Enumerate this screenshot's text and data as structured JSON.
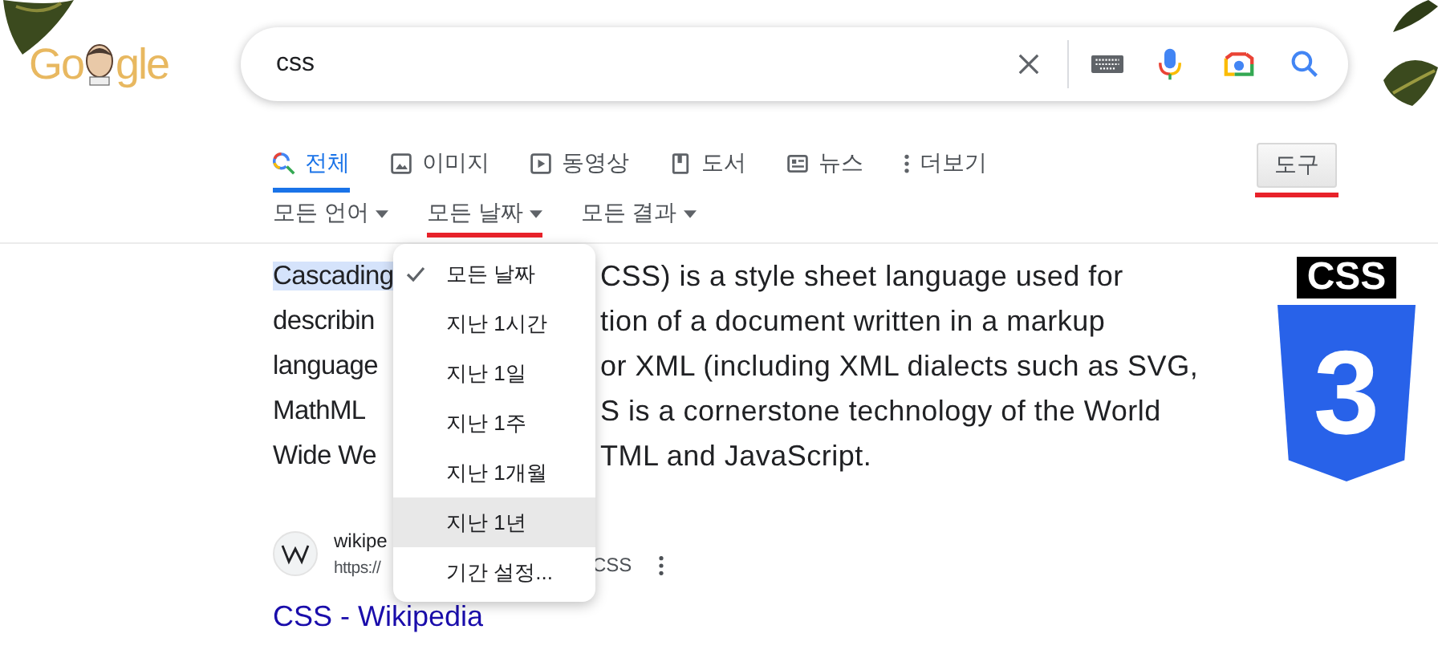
{
  "logo": {
    "before": "Go",
    "after": "gle"
  },
  "search": {
    "value": "css"
  },
  "tabs": [
    {
      "label": "전체",
      "kind": "search",
      "selected": true
    },
    {
      "label": "이미지",
      "kind": "image",
      "selected": false
    },
    {
      "label": "동영상",
      "kind": "video",
      "selected": false
    },
    {
      "label": "도서",
      "kind": "book",
      "selected": false
    },
    {
      "label": "뉴스",
      "kind": "news",
      "selected": false
    },
    {
      "label": "더보기",
      "kind": "more",
      "selected": false
    }
  ],
  "tools": {
    "label": "도구",
    "marked": true
  },
  "filters": [
    {
      "label": "모든 언어",
      "marked": false
    },
    {
      "label": "모든 날짜",
      "marked": true
    },
    {
      "label": "모든 결과",
      "marked": false
    }
  ],
  "date_menu": [
    {
      "label": "모든 날짜",
      "selected": true,
      "highlighted": false
    },
    {
      "label": "지난 1시간",
      "selected": false,
      "highlighted": false
    },
    {
      "label": "지난 1일",
      "selected": false,
      "highlighted": false
    },
    {
      "label": "지난 1주",
      "selected": false,
      "highlighted": false
    },
    {
      "label": "지난 1개월",
      "selected": false,
      "highlighted": false
    },
    {
      "label": "지난 1년",
      "selected": false,
      "highlighted": true
    },
    {
      "label": "기간 설정...",
      "selected": false,
      "highlighted": false
    }
  ],
  "result": {
    "lines": [
      {
        "left": "Cascading",
        "right": "CSS) is a style sheet language used for",
        "selected": true
      },
      {
        "left": "describin",
        "right": "tion of a document written in a markup",
        "selected": false
      },
      {
        "left": "language",
        "right": "or XML (including XML dialects such as SVG,",
        "selected": false
      },
      {
        "left": "MathML",
        "right": "S is a cornerstone technology of the World",
        "selected": false
      },
      {
        "left": "Wide We",
        "right": "TML and JavaScript.",
        "selected": false
      }
    ],
    "site": "wikipe",
    "url": "https://",
    "url_tail": "CSS",
    "title": "CSS - Wikipedia"
  },
  "thumbnail": {
    "label": "CSS",
    "number": "3"
  }
}
